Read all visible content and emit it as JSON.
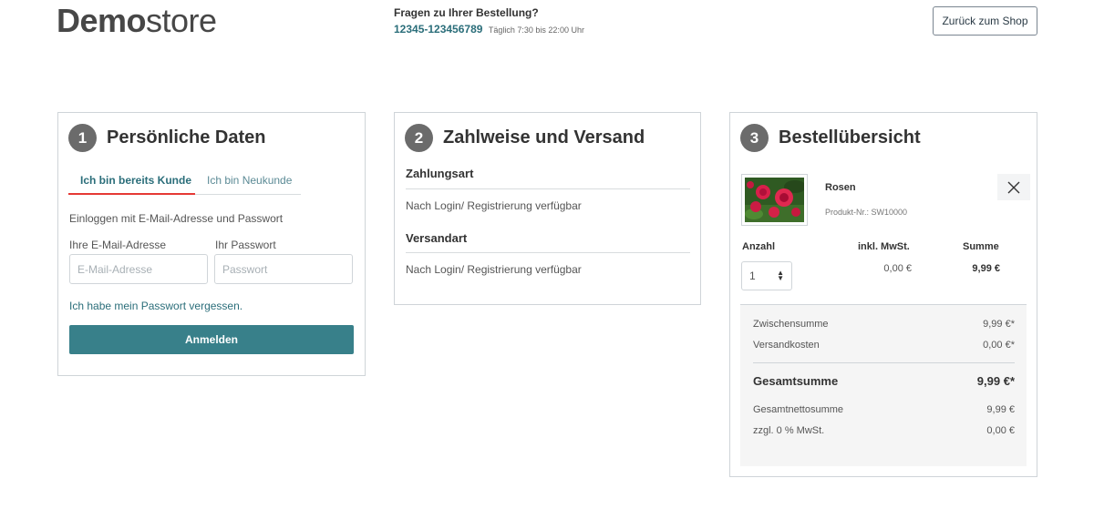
{
  "header": {
    "logo_bold": "Demo",
    "logo_light": "store",
    "help_title": "Fragen zu Ihrer Bestellung?",
    "phone": "12345-123456789",
    "hours": "Täglich 7:30 bis 22:00 Uhr",
    "back_button": "Zurück zum Shop"
  },
  "personal": {
    "step": "1",
    "title": "Persönliche Daten",
    "tab_existing": "Ich bin bereits Kunde",
    "tab_new": "Ich bin Neukunde",
    "intro": "Einloggen mit E-Mail-Adresse und Passwort",
    "email_label": "Ihre E-Mail-Adresse",
    "email_placeholder": "E-Mail-Adresse",
    "password_label": "Ihr Passwort",
    "password_placeholder": "Passwort",
    "forgot_link": "Ich habe mein Passwort vergessen.",
    "login_button": "Anmelden"
  },
  "payment": {
    "step": "2",
    "title": "Zahlweise und Versand",
    "payment_heading": "Zahlungsart",
    "payment_text": "Nach Login/ Registrierung verfügbar",
    "shipping_heading": "Versandart",
    "shipping_text": "Nach Login/ Registrierung verfügbar"
  },
  "overview": {
    "step": "3",
    "title": "Bestellübersicht",
    "product": {
      "name": "Rosen",
      "number": "Produkt-Nr.: SW10000",
      "image_icon": "rose-photo"
    },
    "columns": {
      "quantity": "Anzahl",
      "tax": "inkl. MwSt.",
      "sum": "Summe"
    },
    "quantity_value": "1",
    "tax_value": "0,00 €",
    "sum_value": "9,99 €",
    "summary": {
      "subtotal_label": "Zwischensumme",
      "subtotal_value": "9,99 €*",
      "shipping_label": "Versandkosten",
      "shipping_value": "0,00 €*",
      "total_label": "Gesamtsumme",
      "total_value": "9,99 €*",
      "net_label": "Gesamtnettosumme",
      "net_value": "9,99 €",
      "vat_label": "zzgl. 0 % MwSt.",
      "vat_value": "0,00 €"
    }
  },
  "colors": {
    "accent": "#38808a",
    "link": "#2b6e7a",
    "active_tab_underline": "#e53935"
  }
}
